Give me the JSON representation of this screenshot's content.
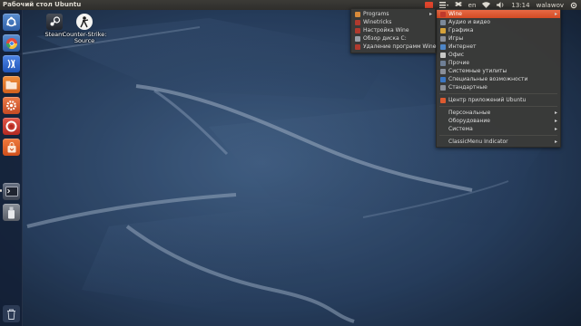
{
  "panel": {
    "title": "Рабочий стол Ubuntu",
    "lang": "en",
    "time": "13:14",
    "user": "walawov"
  },
  "desktop": {
    "icons": [
      {
        "label": "Steam",
        "icon": "steam-icon"
      },
      {
        "label": "Counter-Strike:\nSource",
        "icon": "counter-strike-icon"
      }
    ]
  },
  "launcher": {
    "items": [
      {
        "name": "dash",
        "icon": "ubuntu-logo-icon",
        "color": "#3b6fb8"
      },
      {
        "name": "chromium",
        "icon": "chromium-icon",
        "color": "#3b6fb8"
      },
      {
        "name": "wine",
        "icon": "wine-icon",
        "color": "#2f6dd8"
      },
      {
        "name": "files",
        "icon": "folder-icon",
        "color": "#e0782a"
      },
      {
        "name": "settings",
        "icon": "gear-icon",
        "color": "#d9542a"
      },
      {
        "name": "lifebuoy",
        "icon": "lifebuoy-icon",
        "color": "#c83b30"
      },
      {
        "name": "software-center",
        "icon": "shopping-bag-icon",
        "color": "#e3602b"
      },
      {
        "name": "terminal",
        "icon": "terminal-icon",
        "color": "#4a5060"
      },
      {
        "name": "usb-drive",
        "icon": "usb-drive-icon",
        "color": "#6a6f78"
      }
    ]
  },
  "menu_main": {
    "items": [
      {
        "label": "Wine",
        "icon": "wine-icon",
        "arrow": true,
        "active": true
      },
      {
        "label": "Аудио и видео",
        "icon": "audio-video-icon"
      },
      {
        "label": "Графика",
        "icon": "graphics-icon"
      },
      {
        "label": "Игры",
        "icon": "games-icon"
      },
      {
        "label": "Интернет",
        "icon": "internet-icon"
      },
      {
        "label": "Офис",
        "icon": "office-icon"
      },
      {
        "label": "Прочие",
        "icon": "other-icon"
      },
      {
        "label": "Системные утилиты",
        "icon": "system-tools-icon"
      },
      {
        "label": "Специальные возможности",
        "icon": "accessibility-icon"
      },
      {
        "label": "Стандартные",
        "icon": "accessories-icon"
      },
      {
        "separator": true
      },
      {
        "label": "Центр приложений Ubuntu",
        "icon": "software-center-icon"
      },
      {
        "separator": true
      },
      {
        "label": "Персональные",
        "arrow": true
      },
      {
        "label": "Оборудование",
        "arrow": true
      },
      {
        "label": "Система",
        "arrow": true
      },
      {
        "separator": true
      },
      {
        "label": "ClassicMenu Indicator",
        "arrow": true
      }
    ]
  },
  "menu_wine": {
    "items": [
      {
        "label": "Programs",
        "icon": "folder-icon",
        "arrow": true
      },
      {
        "label": "Winetricks",
        "icon": "winetricks-icon"
      },
      {
        "label": "Настройка Wine",
        "icon": "wine-config-icon"
      },
      {
        "label": "Обзор диска C:",
        "icon": "drive-icon"
      },
      {
        "label": "Удаление программ Wine",
        "icon": "uninstall-icon"
      }
    ]
  },
  "colors": {
    "accent": "#dd5a30",
    "panel": "#3c3b37",
    "menu_bg": "#3a3a38"
  }
}
